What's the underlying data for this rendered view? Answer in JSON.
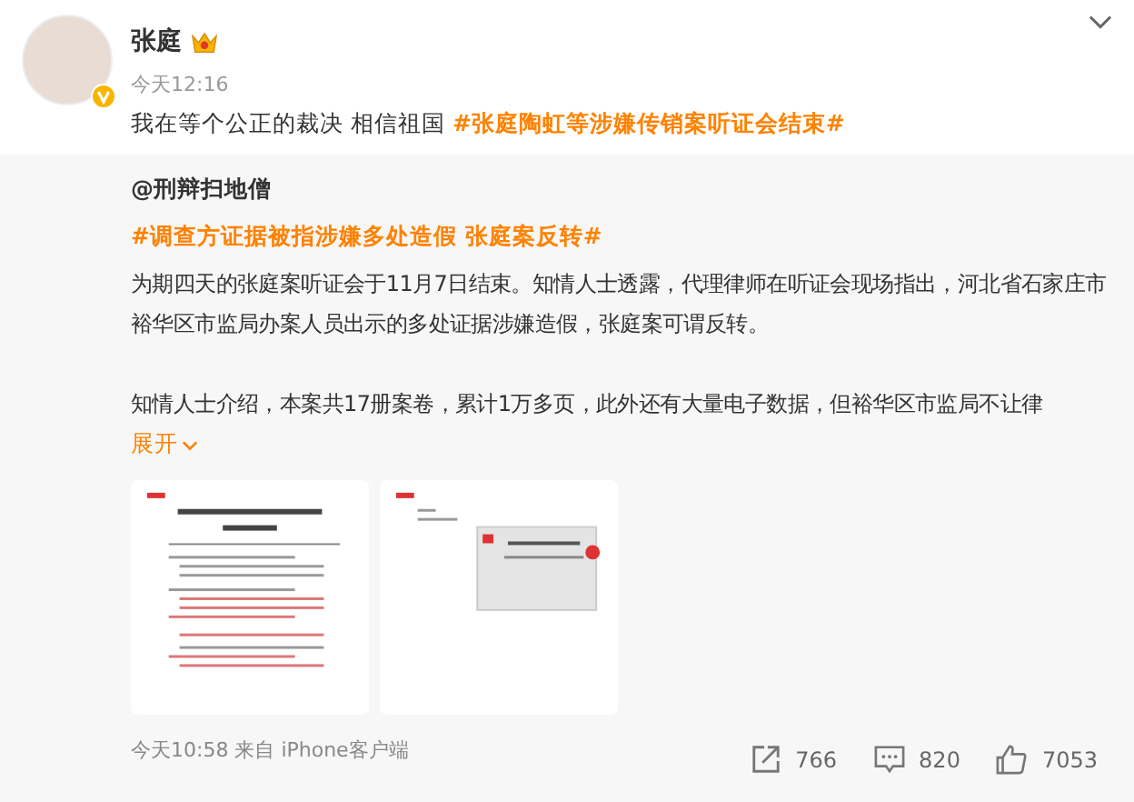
{
  "author": {
    "name": "张庭",
    "time": "今天12:16"
  },
  "post": {
    "text": "我在等个公正的裁决 相信祖国",
    "hashtag": "#张庭陶虹等涉嫌传销案听证会结束#"
  },
  "repost": {
    "author": "@刑辩扫地僧",
    "hashtag": "#调查方证据被指涉嫌多处造假 张庭案反转#",
    "paragraphs": [
      "为期四天的张庭案听证会于11月7日结束。知情人士透露，代理律师在听证会现场指出，河北省石家庄市裕华区市监局办案人员出示的多处证据涉嫌造假，张庭案可谓反转。",
      "知情人士介绍，本案共17册案卷，累计1万多页，此外还有大量电子数据，但裕华区市监局不让律"
    ],
    "expand": "展开",
    "images": [
      {
        "kind": "letter"
      },
      {
        "kind": "certificate"
      }
    ],
    "source": "今天10:58 来自 iPhone客户端",
    "actions": [
      {
        "kind": "share",
        "count": "766"
      },
      {
        "kind": "comment",
        "count": "820"
      },
      {
        "kind": "like",
        "count": "7053"
      }
    ]
  }
}
